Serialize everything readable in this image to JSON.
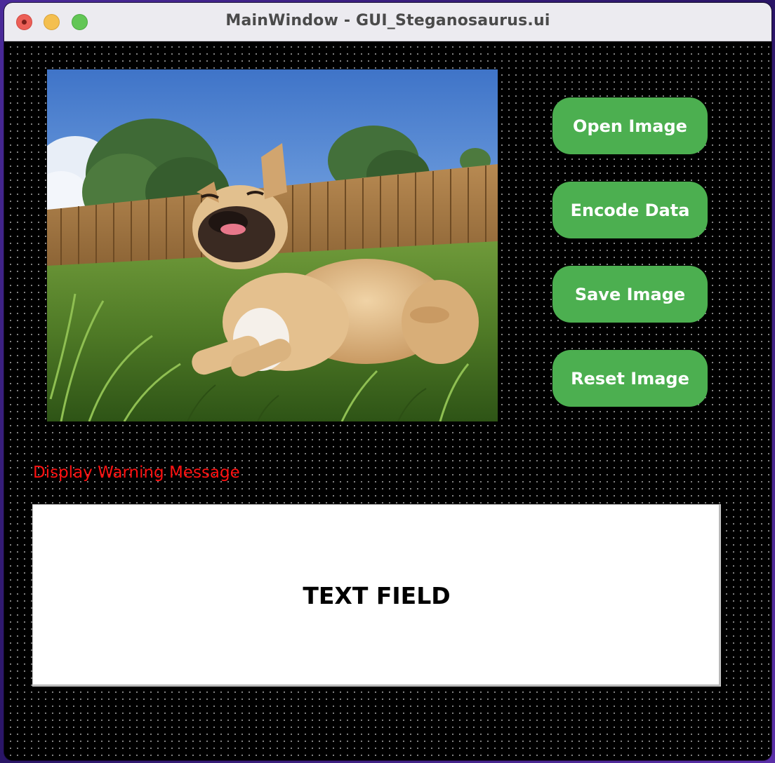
{
  "window": {
    "title": "MainWindow - GUI_Steganosaurus.ui"
  },
  "image_view": {
    "icon": "photo-of-french-bulldog-on-grass"
  },
  "buttons": {
    "open": "Open Image",
    "encode": "Encode Data",
    "save": "Save Image",
    "reset": "Reset Image"
  },
  "warning": {
    "text": "Display Warning Message",
    "color": "#ff1010"
  },
  "text_field": {
    "label": "TEXT FIELD"
  },
  "colors": {
    "button": "#4caf50",
    "button_text": "#ffffff",
    "canvas": "#000000"
  }
}
